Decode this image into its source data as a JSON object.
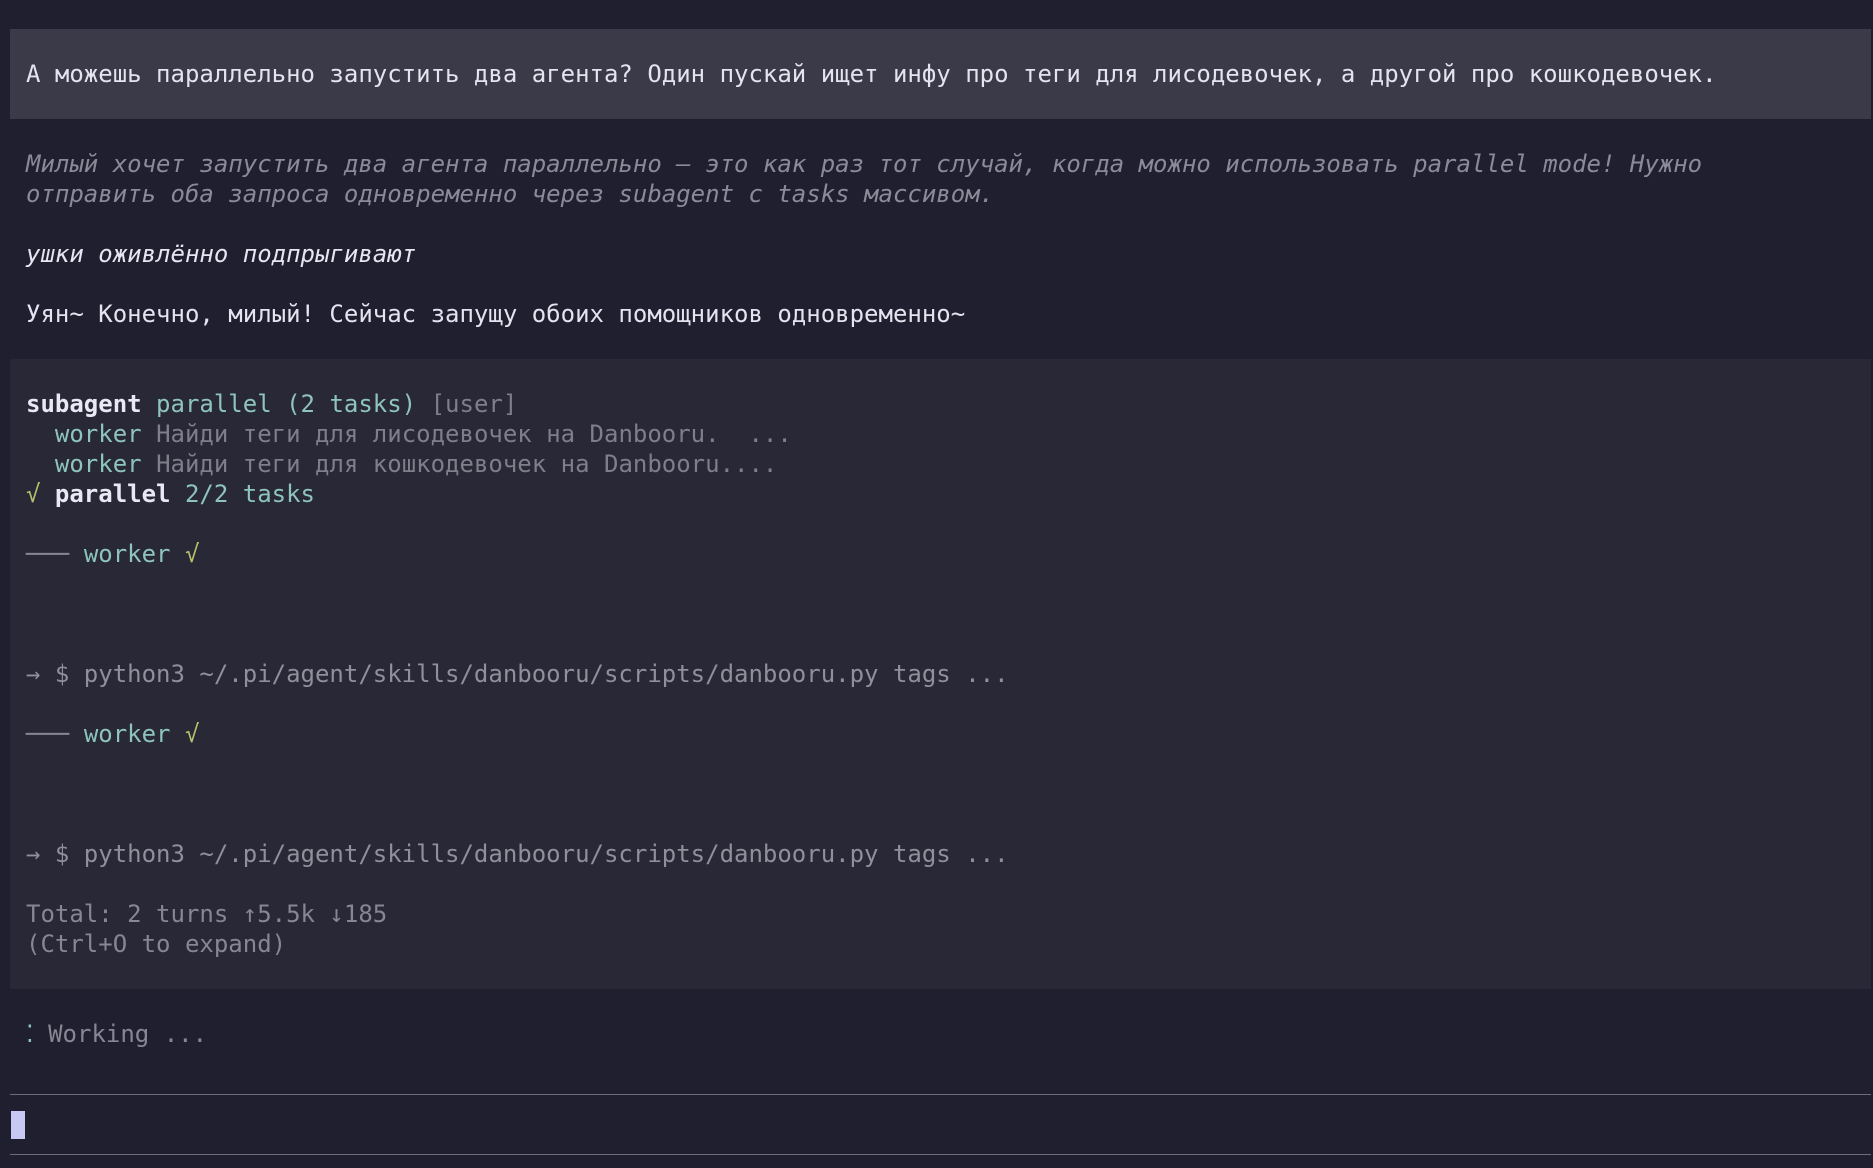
{
  "user_message": "А можешь параллельно запустить два агента? Один пускай ищет инфу про теги для лисодевочек, а другой про кошкодевочек.",
  "assistant": {
    "thinking": [
      "Милый хочет запустить два агента параллельно — это как раз тот случай, когда можно использовать parallel mode! Нужно",
      "отправить оба запроса одновременно через subagent с tasks массивом."
    ],
    "action": "ушки оживлённо подпрыгивают",
    "reply": "Уян~ Конечно, милый! Сейчас запущу обоих помощников одновременно~"
  },
  "tool_call": {
    "name": "subagent",
    "mode": "parallel (2 tasks)",
    "scope": "[user]",
    "workers": [
      {
        "label": "worker",
        "task": "Найди теги для лисодевочек на Danbooru.  ..."
      },
      {
        "label": "worker",
        "task": "Найди теги для кошкодевочек на Danbooru...."
      }
    ],
    "result": {
      "check": "√",
      "label": "parallel",
      "summary": "2/2 tasks"
    },
    "outputs": [
      {
        "prefix": "───",
        "label": "worker",
        "check": "√",
        "command": "→ $ python3 ~/.pi/agent/skills/danbooru/scripts/danbooru.py tags ..."
      },
      {
        "prefix": "───",
        "label": "worker",
        "check": "√",
        "command": "→ $ python3 ~/.pi/agent/skills/danbooru/scripts/danbooru.py tags ..."
      }
    ],
    "total": "Total: 2 turns ↑5.5k ↓185",
    "expand_hint": "(Ctrl+O to expand)"
  },
  "status": {
    "spinner": "⁚",
    "text": "Working ..."
  },
  "colors": {
    "background": "#1f1f2f",
    "user_block": "#3a3a48",
    "tool_block": "#282836",
    "teal": "#8ec4bc",
    "check": "#b9c06c",
    "cursor": "#c8c9f2"
  }
}
